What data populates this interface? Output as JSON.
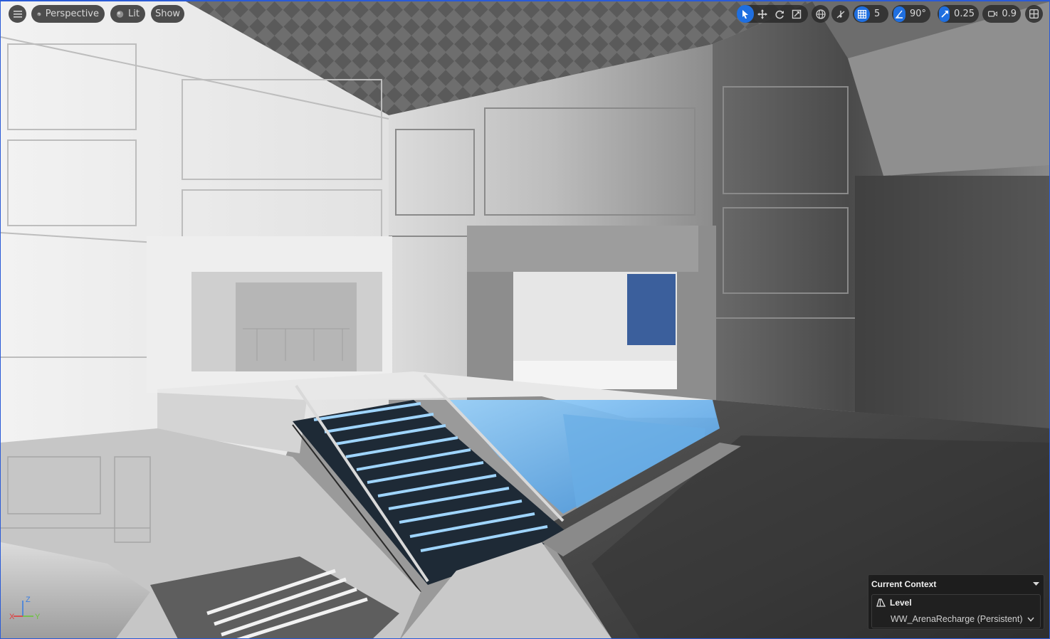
{
  "toolbar": {
    "view_mode": "Perspective",
    "lit_label": "Lit",
    "show_label": "Show",
    "grid_snap_value": "5",
    "rotation_snap_value": "90°",
    "scale_snap_value": "0.25",
    "camera_speed_value": "0.9",
    "icons": [
      "hamburger-menu-icon",
      "cube-icon",
      "sphere-icon",
      "select-arrow-icon",
      "translate-icon",
      "rotate-icon",
      "scale-icon",
      "world-globe-icon",
      "surface-snap-icon",
      "grid-icon",
      "angle-icon",
      "scale-arrow-icon",
      "camera-icon",
      "layout-grid-icon"
    ]
  },
  "context_panel": {
    "title": "Current Context",
    "level_label": "Level",
    "level_value": "WW_ArenaRecharge (Persistent)"
  },
  "axis_gizmo": {
    "z": "Z",
    "x": "X",
    "y": "Y"
  },
  "colors": {
    "accent": "#1f6fe0",
    "axis_x": "#e03c3c",
    "axis_y": "#6cc43c",
    "axis_z": "#3c7fe0",
    "stair_glow": "#55b8f5"
  }
}
